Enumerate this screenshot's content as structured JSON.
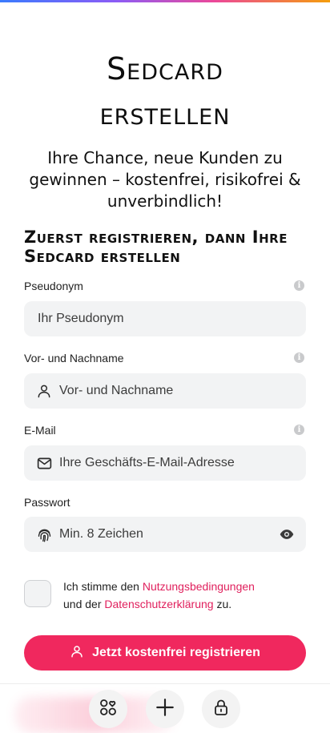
{
  "title": {
    "line1": "Sedcard",
    "line2": "erstellen"
  },
  "subtitle": "Ihre Chance, neue Kunden zu gewinnen – kostenfrei, risikofrei & unverbindlich!",
  "section_heading": "Zuerst registrieren, dann Ihre Sedcard erstellen",
  "form": {
    "pseudonym": {
      "label": "Pseudonym",
      "placeholder": "Ihr Pseudonym"
    },
    "name": {
      "label": "Vor- und Nachname",
      "placeholder": "Vor- und Nachname",
      "icon": "user-icon"
    },
    "email": {
      "label": "E-Mail",
      "placeholder": "Ihre Geschäfts-E-Mail-Adresse",
      "icon": "envelope-icon"
    },
    "password": {
      "label": "Passwort",
      "placeholder": "Min. 8 Zeichen",
      "icon": "fingerprint-icon",
      "toggle_icon": "eye-icon"
    }
  },
  "consent": {
    "prefix": "Ich stimme den ",
    "terms_link": "Nutzungsbedingungen",
    "middle": " und der ",
    "privacy_link": "Datenschutzerklärung",
    "suffix": " zu."
  },
  "cta": {
    "label": "Jetzt kostenfrei registrieren",
    "icon": "user-icon"
  },
  "bottom_nav": [
    {
      "icon": "apps-heart-icon"
    },
    {
      "icon": "plus-icon"
    },
    {
      "icon": "lock-icon"
    }
  ],
  "colors": {
    "accent": "#f0285e",
    "link": "#e01f5c",
    "field_bg": "#f2f3f4"
  }
}
